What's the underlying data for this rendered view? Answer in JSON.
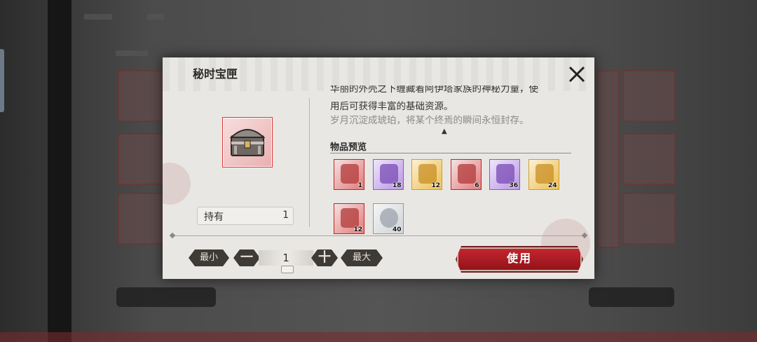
{
  "dialog": {
    "title": "秘时宝匣",
    "description_lines": [
      "华丽的外壳之下缠藏着阿伊塔家族的神秘力量，使",
      "用后可获得丰富的基础资源。",
      "岁月沉淀成琥珀，将某个终焉的瞬间永恒封存。"
    ],
    "owned_label": "持有",
    "owned_value": "1",
    "preview_title": "物品预览",
    "scroll_indicator": "▲",
    "preview_items": [
      {
        "count": "1",
        "rarity": "red",
        "icon": "blue-figurine-icon"
      },
      {
        "count": "18",
        "rarity": "purple",
        "icon": "purple-book-icon"
      },
      {
        "count": "12",
        "rarity": "gold",
        "icon": "gold-book-icon"
      },
      {
        "count": "6",
        "rarity": "red",
        "icon": "red-book-icon"
      },
      {
        "count": "36",
        "rarity": "purple",
        "icon": "purple-crystal-book-icon"
      },
      {
        "count": "24",
        "rarity": "gold",
        "icon": "gold-coin-book-icon"
      },
      {
        "count": "12",
        "rarity": "red",
        "icon": "red-sigil-icon"
      },
      {
        "count": "40",
        "rarity": "plain",
        "icon": "silver-emblem-icon"
      }
    ]
  },
  "footer": {
    "min_label": "最小",
    "minus_label": "一",
    "quantity": "1",
    "plus_label": "十",
    "max_label": "最大",
    "use_label": "使用"
  },
  "colors": {
    "use_button": "#b31b24",
    "red_rarity": "#c52323",
    "purple_rarity": "#8a5bc2",
    "gold_rarity": "#d59b2a"
  }
}
